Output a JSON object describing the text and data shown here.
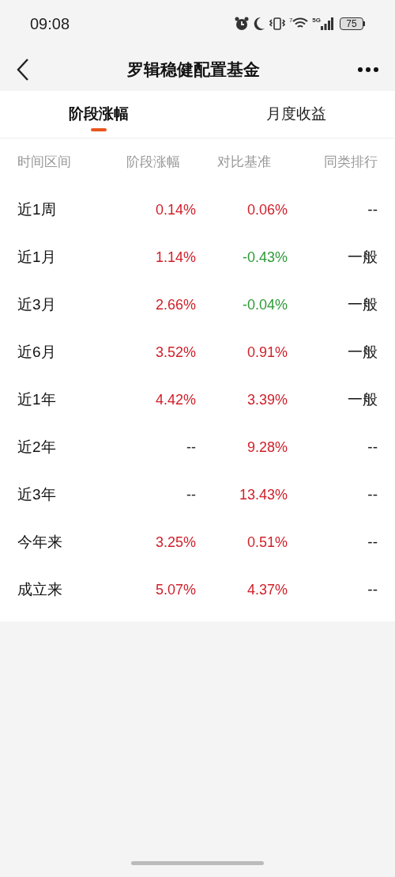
{
  "status_bar": {
    "time": "09:08",
    "wifi_badge": "7",
    "network": "5G",
    "battery": "75"
  },
  "header": {
    "title": "罗辑稳健配置基金"
  },
  "tabs": [
    {
      "label": "阶段涨幅",
      "selected": true
    },
    {
      "label": "月度收益",
      "selected": false
    }
  ],
  "table": {
    "columns": [
      "时间区间",
      "阶段涨幅",
      "对比基准",
      "同类排行"
    ],
    "rows": [
      {
        "period": "近1周",
        "change": {
          "text": "0.14%",
          "color": "#d0202a"
        },
        "benchmark": {
          "text": "0.06%",
          "color": "#d0202a"
        },
        "rank": "--"
      },
      {
        "period": "近1月",
        "change": {
          "text": "1.14%",
          "color": "#d0202a"
        },
        "benchmark": {
          "text": "-0.43%",
          "color": "#2e9a38"
        },
        "rank": "一般"
      },
      {
        "period": "近3月",
        "change": {
          "text": "2.66%",
          "color": "#d0202a"
        },
        "benchmark": {
          "text": "-0.04%",
          "color": "#2e9a38"
        },
        "rank": "一般"
      },
      {
        "period": "近6月",
        "change": {
          "text": "3.52%",
          "color": "#d0202a"
        },
        "benchmark": {
          "text": "0.91%",
          "color": "#d0202a"
        },
        "rank": "一般"
      },
      {
        "period": "近1年",
        "change": {
          "text": "4.42%",
          "color": "#d0202a"
        },
        "benchmark": {
          "text": "3.39%",
          "color": "#d0202a"
        },
        "rank": "一般"
      },
      {
        "period": "近2年",
        "change": {
          "text": "--",
          "color": "#222222"
        },
        "benchmark": {
          "text": "9.28%",
          "color": "#d0202a"
        },
        "rank": "--"
      },
      {
        "period": "近3年",
        "change": {
          "text": "--",
          "color": "#222222"
        },
        "benchmark": {
          "text": "13.43%",
          "color": "#d0202a"
        },
        "rank": "--"
      },
      {
        "period": "今年来",
        "change": {
          "text": "3.25%",
          "color": "#d0202a"
        },
        "benchmark": {
          "text": "0.51%",
          "color": "#d0202a"
        },
        "rank": "--"
      },
      {
        "period": "成立来",
        "change": {
          "text": "5.07%",
          "color": "#d0202a"
        },
        "benchmark": {
          "text": "4.37%",
          "color": "#d0202a"
        },
        "rank": "--"
      }
    ]
  }
}
